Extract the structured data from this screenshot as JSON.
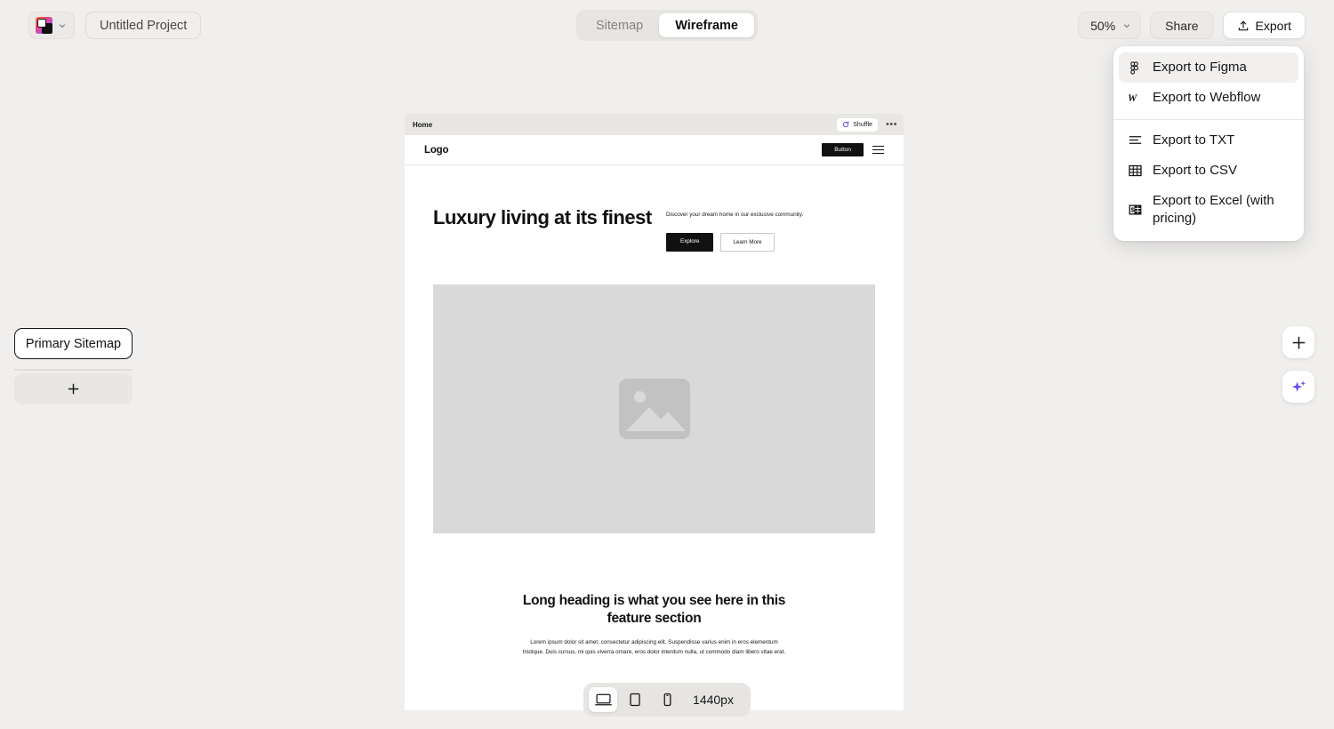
{
  "topbar": {
    "logo_icon": "app-logo-squares-icon",
    "logo_chevron_icon": "chevron-down-icon",
    "project_name": "Untitled Project",
    "tabs": [
      {
        "label": "Sitemap",
        "active": false
      },
      {
        "label": "Wireframe",
        "active": true
      }
    ],
    "zoom_level": "50%",
    "zoom_chevron_icon": "chevron-down-icon",
    "share_label": "Share",
    "export_label": "Export",
    "export_icon": "upload-icon"
  },
  "export_menu": {
    "items": [
      {
        "label": "Export to Figma",
        "icon": "figma-icon",
        "highlighted": true
      },
      {
        "label": "Export to Webflow",
        "icon": "webflow-w-icon",
        "highlighted": false
      },
      {
        "label": "Export to TXT",
        "icon": "text-lines-icon",
        "highlighted": false
      },
      {
        "label": "Export to CSV",
        "icon": "table-grid-icon",
        "highlighted": false
      },
      {
        "label": "Export to Excel (with pricing)",
        "icon": "table-dollar-icon",
        "highlighted": false
      }
    ]
  },
  "sidebar": {
    "sitemap_label": "Primary Sitemap",
    "add_icon": "plus-icon"
  },
  "frame": {
    "title": "Home",
    "shuffle_label": "Shuffle",
    "shuffle_icon": "shuffle-refresh-icon",
    "more_icon": "ellipsis-icon"
  },
  "wireframe": {
    "nav": {
      "logo": "Logo",
      "button_label": "Button",
      "menu_icon": "hamburger-menu-icon"
    },
    "hero": {
      "heading": "Luxury living at its finest",
      "paragraph": "Discover your dream home in our exclusive community.",
      "primary_button": "Explore",
      "secondary_button": "Learn More",
      "image_icon": "image-placeholder-icon"
    },
    "feature": {
      "heading": "Long heading is what you see here in this feature section",
      "paragraph": "Lorem ipsum dolor sit amet, consectetur adipiscing elit. Suspendisse varius enim in eros elementum tristique. Duis cursus, mi quis viverra ornare, eros dolor interdum nulla, ut commodo diam libero vitae erat."
    }
  },
  "devicebar": {
    "devices": [
      {
        "name": "desktop",
        "icon": "desktop-icon",
        "active": true
      },
      {
        "name": "tablet",
        "icon": "tablet-icon",
        "active": false
      },
      {
        "name": "mobile",
        "icon": "mobile-icon",
        "active": false
      }
    ],
    "width_label": "1440px"
  },
  "fabs": {
    "add_icon": "plus-icon",
    "ai_icon": "ai-sparkle-icon"
  },
  "colors": {
    "canvas_bg": "#f0efed",
    "accent_purple": "#6c4cf5",
    "text_primary": "#17161a",
    "wireframe_dark": "#111111",
    "image_placeholder": "#d9d9d9"
  }
}
